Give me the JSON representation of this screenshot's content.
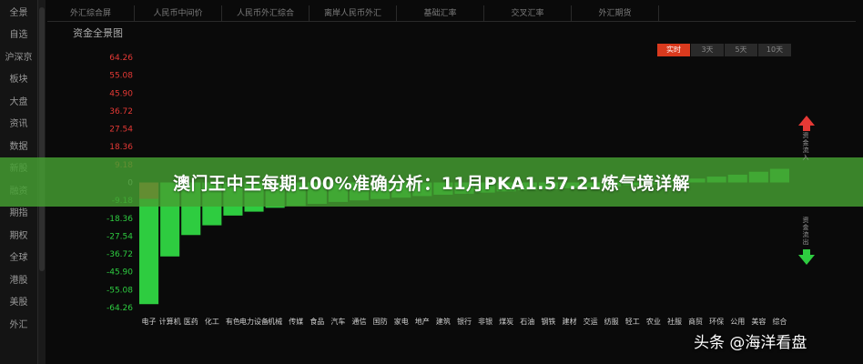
{
  "sidebar": {
    "items": [
      "全景",
      "自选",
      "沪深京",
      "板块",
      "大盘",
      "资讯",
      "数据",
      "新股",
      "融资",
      "期指",
      "期权",
      "全球",
      "港股",
      "美股",
      "外汇"
    ]
  },
  "topnav": {
    "tabs": [
      "外汇综合屏",
      "人民币中间价",
      "人民币外汇综合",
      "离岸人民币外汇",
      "基础汇率",
      "交叉汇率",
      "外汇期货"
    ]
  },
  "chart_title": "资金全景图",
  "periods": [
    {
      "label": "实时",
      "active": true
    },
    {
      "label": "3天",
      "active": false
    },
    {
      "label": "5天",
      "active": false
    },
    {
      "label": "10天",
      "active": false
    }
  ],
  "banner": "澳门王中王每期100%准确分析：11月PKA1.57.21炼气境详解",
  "watermark": "头条 @海洋看盘",
  "side_labels": {
    "inflow": "资金流入",
    "outflow": "资金流出"
  },
  "chart_data": {
    "type": "bar",
    "yticks": [
      "64.26",
      "55.08",
      "45.90",
      "36.72",
      "27.54",
      "18.36",
      "9.18",
      "0",
      "-9.18",
      "-18.36",
      "-27.54",
      "-36.72",
      "-45.90",
      "-55.08",
      "-64.26"
    ],
    "ylim": [
      -64.26,
      64.26
    ],
    "categories": [
      "电子",
      "计算机",
      "医药",
      "化工",
      "有色",
      "电力设备",
      "机械",
      "传媒",
      "食品",
      "汽车",
      "通信",
      "国防",
      "家电",
      "地产",
      "建筑",
      "银行",
      "非银",
      "煤炭",
      "石油",
      "钢铁",
      "建材",
      "交运",
      "纺服",
      "轻工",
      "农业",
      "社服",
      "商贸",
      "环保",
      "公用",
      "美容",
      "综合"
    ],
    "values": [
      -62.5,
      -38.0,
      -27.0,
      -22.0,
      -17.0,
      -15.0,
      -13.0,
      -12.0,
      -11.0,
      -10.0,
      -9.2,
      -8.5,
      -7.8,
      -7.0,
      -6.3,
      -5.8,
      -5.2,
      -4.6,
      -4.0,
      -3.5,
      -3.0,
      -2.5,
      -2.0,
      -1.5,
      -1.0,
      1.0,
      2.0,
      3.0,
      4.0,
      5.5,
      7.0
    ]
  },
  "colors": {
    "up": "#e53935",
    "down": "#2ecc40",
    "banner": "#46a032"
  }
}
